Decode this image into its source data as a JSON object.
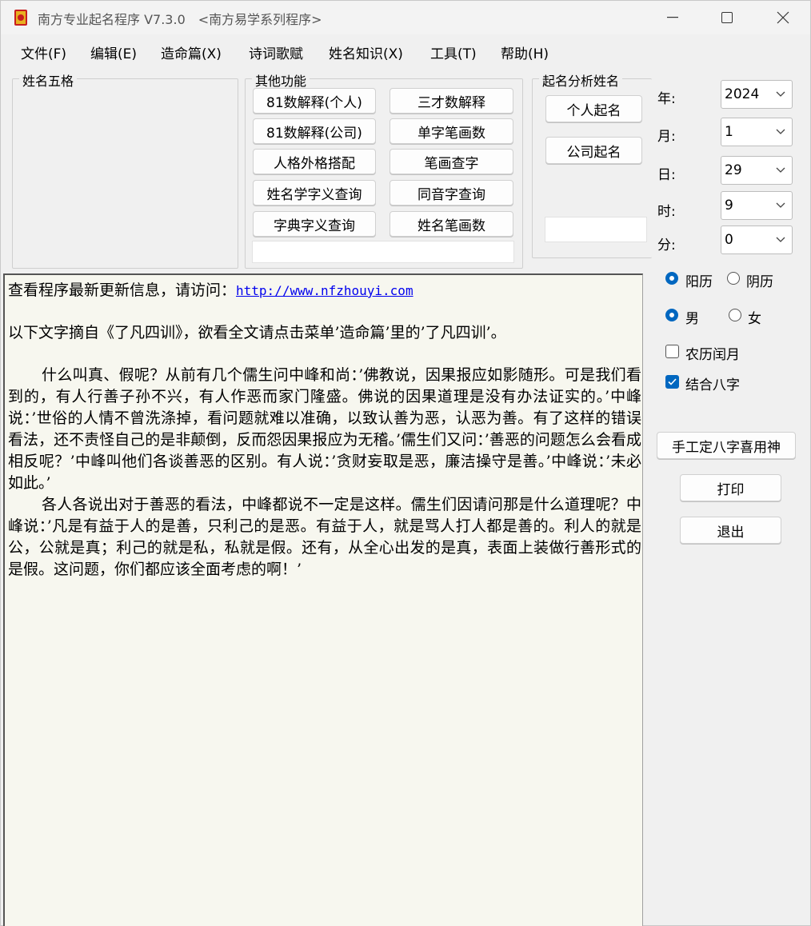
{
  "window": {
    "title": "南方专业起名程序 V7.3.0",
    "subtitle": "<南方易学系列程序>"
  },
  "menu": [
    "文件(F)",
    "编辑(E)",
    "造命篇(X)",
    "诗词歌赋",
    "姓名知识(X)",
    "工具(T)",
    "帮助(H)"
  ],
  "groups": {
    "wuge": "姓名五格",
    "other": "其他功能",
    "analysis": "起名分析姓名"
  },
  "other_buttons": {
    "b1": "81数解释(个人)",
    "b2": "三才数解释",
    "b3": "81数解释(公司)",
    "b4": "单字笔画数",
    "b5": "人格外格搭配",
    "b6": "笔画查字",
    "b7": "姓名学字义查询",
    "b8": "同音字查询",
    "b9": "字典字义查询",
    "b10": "姓名笔画数"
  },
  "analysis_buttons": {
    "personal": "个人起名",
    "company": "公司起名"
  },
  "datetime": {
    "year_label": "年:",
    "year": "2024",
    "month_label": "月:",
    "month": "1",
    "day_label": "日:",
    "day": "29",
    "hour_label": "时:",
    "hour": "9",
    "minute_label": "分:",
    "minute": "0"
  },
  "options": {
    "solar": "阳历",
    "lunar": "阴历",
    "male": "男",
    "female": "女",
    "leap_month": "农历闰月",
    "combine_bazi": "结合八字"
  },
  "actions": {
    "manual_bazi": "手工定八字喜用神",
    "print": "打印",
    "exit": "退出"
  },
  "content": {
    "update_prefix": "查看程序最新更新信息，请访问：",
    "update_url": "http://www.nfzhouyi.com",
    "intro": "以下文字摘自《了凡四训》，欲看全文请点击菜单’造命篇’里的’了凡四训’。",
    "para1": "什么叫真、假呢？从前有几个儒生问中峰和尚：’佛教说，因果报应如影随形。可是我们看到的，有人行善子孙不兴，有人作恶而家门隆盛。佛说的因果道理是没有办法证实的。’中峰说：’世俗的人情不曾洗涤掉，看问题就难以准确，以致认善为恶，认恶为善。有了这样的错误看法，还不责怪自己的是非颠倒，反而怨因果报应为无稽。’儒生们又问：’善恶的问题怎么会看成相反呢？’中峰叫他们各谈善恶的区别。有人说：’贪财妄取是恶，廉洁操守是善。’中峰说：’未必如此。’",
    "para2": "各人各说出对于善恶的看法，中峰都说不一定是这样。儒生们因请问那是什么道理呢？中峰说：’凡是有益于人的是善，只利己的是恶。有益于人，就是骂人打人都是善的。利人的就是公，公就是真；利己的就是私，私就是假。还有，从全心出发的是真，表面上装做行善形式的是假。这问题，你们都应该全面考虑的啊！’"
  }
}
